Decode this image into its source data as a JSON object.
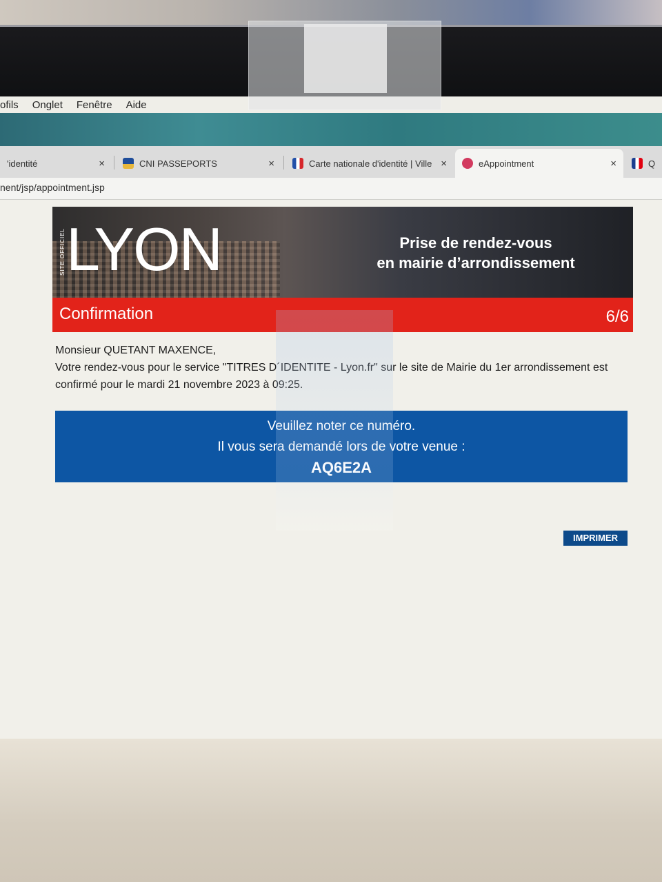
{
  "menubar": {
    "items": [
      "ofils",
      "Onglet",
      "Fenêtre",
      "Aide"
    ]
  },
  "tabs": [
    {
      "label": "'identité",
      "close": "×"
    },
    {
      "label": "CNI PASSEPORTS",
      "close": "×"
    },
    {
      "label": "Carte nationale d'identité | Ville",
      "close": "×"
    },
    {
      "label": "eAppointment",
      "close": "×",
      "active": true
    },
    {
      "label": "Qu"
    }
  ],
  "address": {
    "url": "nent/jsp/appointment.jsp"
  },
  "banner": {
    "site_label": "SITE OFFICIEL",
    "logo": "LYON",
    "title_line1": "Prise de rendez-vous",
    "title_line2": "en mairie d’arrondissement"
  },
  "confirmation": {
    "title": "Confirmation",
    "step": "6/6"
  },
  "message": {
    "greeting": "Monsieur QUETANT MAXENCE,",
    "body": "Votre rendez-vous pour le service \"TITRES D´IDENTITE - Lyon.fr\" sur le site de Mairie du 1er arrondissement est confirmé pour le mardi 21 novembre 2023 à 09:25."
  },
  "notice": {
    "line1": "Veuillez noter ce numéro.",
    "line2": "Il vous sera demandé lors de votre venue :",
    "code": "AQ6E2A"
  },
  "actions": {
    "print_label": "IMPRIMER"
  },
  "colors": {
    "brand_red": "#e2231a",
    "notice_blue": "#0d56a4",
    "button_blue": "#0d4a8a"
  }
}
